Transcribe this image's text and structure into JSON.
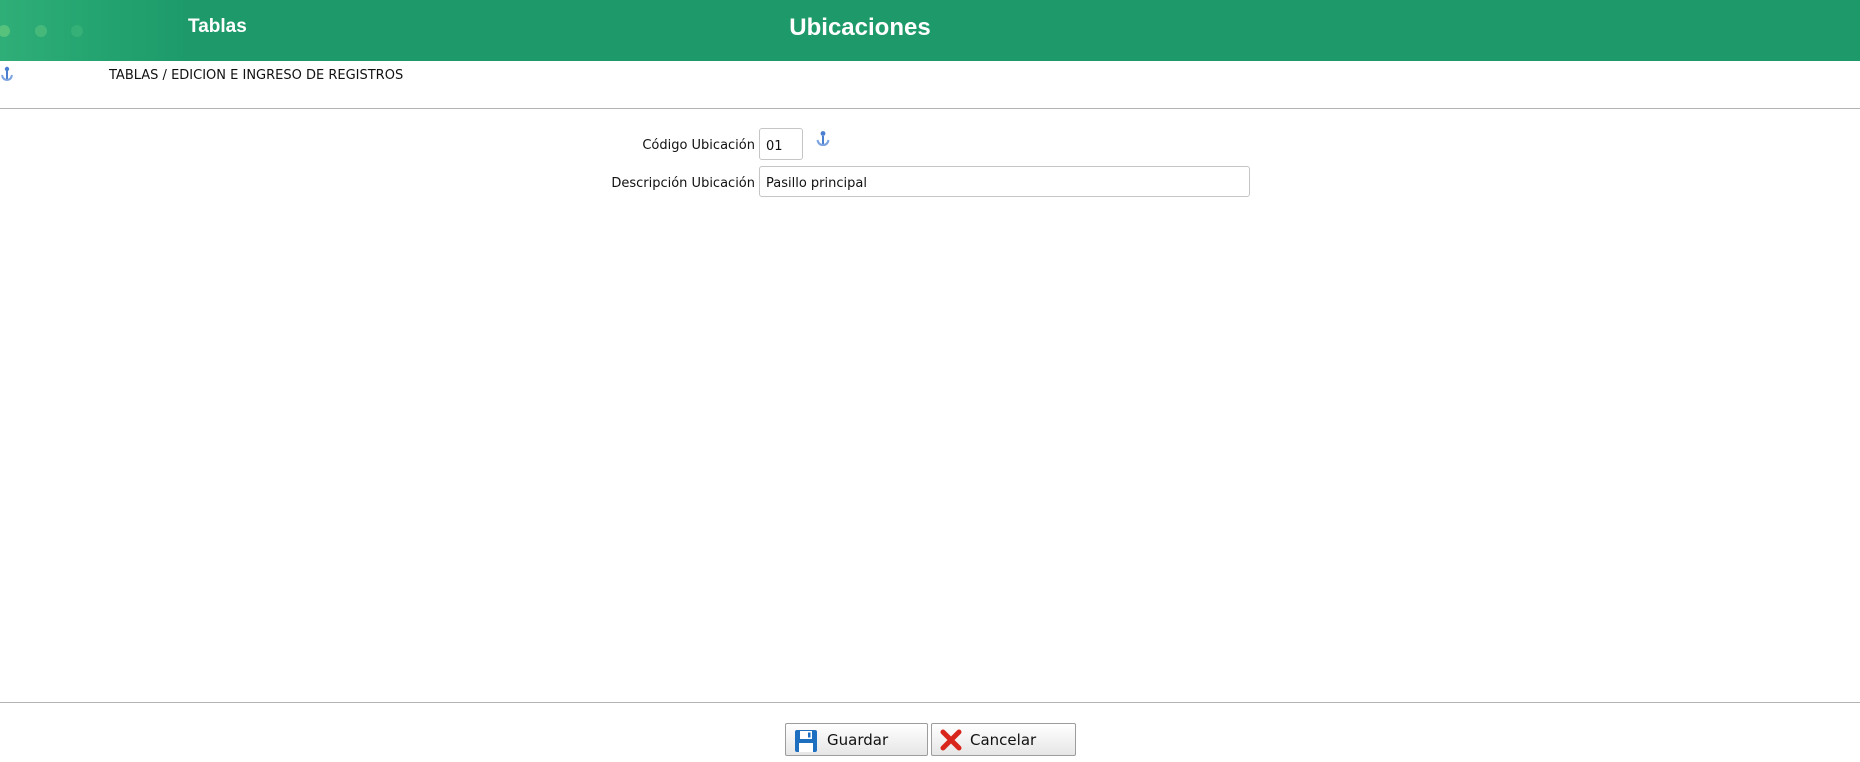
{
  "header": {
    "section": "Tablas",
    "title": "Ubicaciones"
  },
  "breadcrumb": {
    "text": "TABLAS / EDICION E INGRESO DE REGISTROS"
  },
  "form": {
    "codigo": {
      "label": "Código Ubicación",
      "value": "01"
    },
    "descripcion": {
      "label": "Descripción Ubicación",
      "value": "Pasillo principal"
    }
  },
  "buttons": {
    "save_label": "Guardar",
    "cancel_label": "Cancelar"
  },
  "colors": {
    "header_green": "#1e9a6a",
    "save_icon_blue": "#1f6fc1",
    "cancel_icon_red": "#d9261c"
  },
  "icons": {
    "breadcrumb": "help-anchor-icon",
    "codigo_help": "help-anchor-icon",
    "save": "floppy-disk-icon",
    "cancel": "red-x-icon"
  }
}
